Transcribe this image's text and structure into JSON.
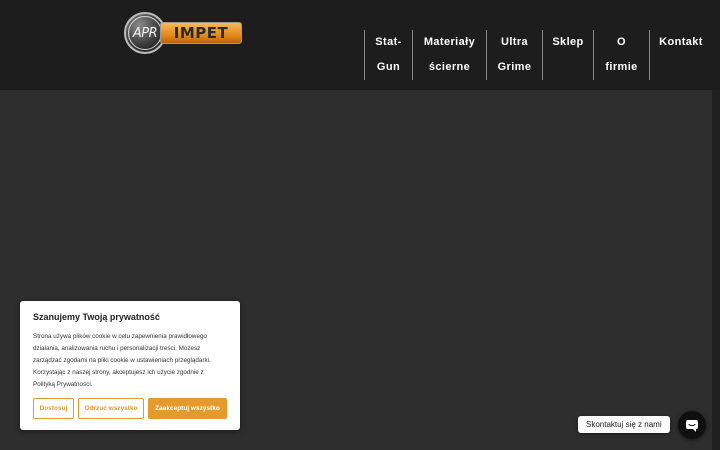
{
  "header": {
    "logo": {
      "circle_text": "APR",
      "brand_text": "IMPET"
    },
    "nav": [
      {
        "label": "Stat-Gun"
      },
      {
        "label": "Materiały ścierne"
      },
      {
        "label": "Ultra Grime"
      },
      {
        "label": "Sklep"
      },
      {
        "label": "O firmie"
      },
      {
        "label": "Kontakt"
      }
    ]
  },
  "cookie_banner": {
    "title": "Szanujemy Twoją prywatność",
    "text": "Strona używa plików cookie w celu zapewnienia prawidłowego działania, analizowania ruchu i personalizacji treści. Możesz zarządzać zgodami na pliki cookie w ustawieniach przeglądarki. Korzystając z naszej strony, akceptujesz ich użycie zgodnie z Polityką Prywatności.",
    "buttons": {
      "customize": "Dostosuj",
      "reject": "Odrzuć wszystko",
      "accept": "Zaakceptuj wszystko"
    }
  },
  "chat": {
    "label": "Skontaktuj się z nami"
  },
  "colors": {
    "header_bg": "#1d1d1d",
    "page_bg": "#2e2e2e",
    "accent": "#e59b2b",
    "logo_orange": "#e58a1a"
  }
}
